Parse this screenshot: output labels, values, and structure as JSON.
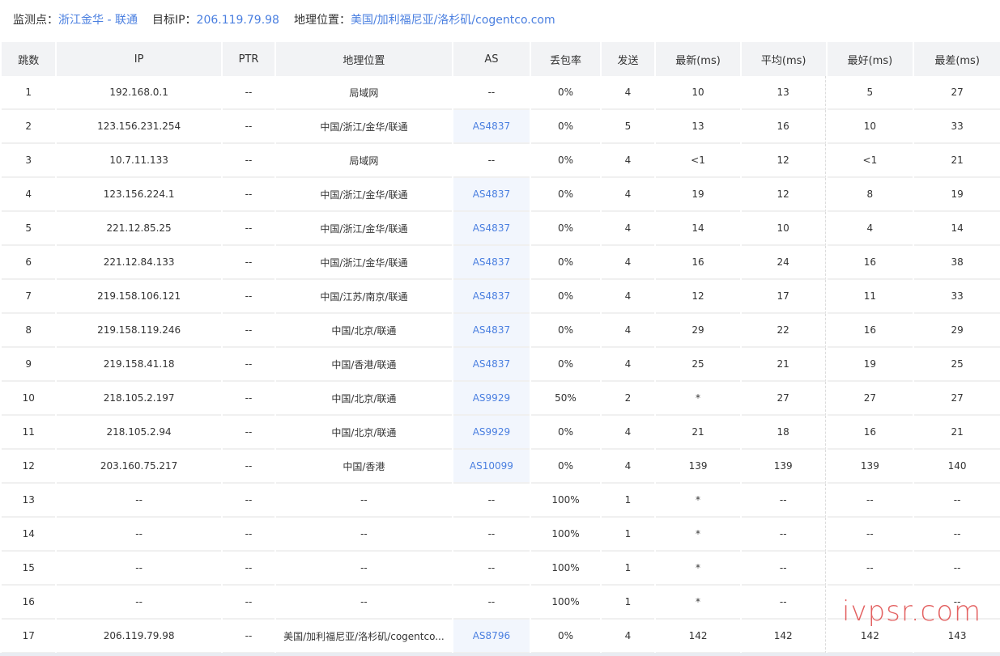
{
  "header": {
    "monitor_label": "监测点：",
    "monitor_value": "浙江金华 - 联通",
    "target_label": "目标IP：",
    "target_value": "206.119.79.98",
    "geo_label": "地理位置：",
    "geo_value": "美国/加利福尼亚/洛杉矶/cogentco.com"
  },
  "table": {
    "columns": [
      "跳数",
      "IP",
      "PTR",
      "地理位置",
      "AS",
      "丢包率",
      "发送",
      "最新(ms)",
      "平均(ms)",
      "最好(ms)",
      "最差(ms)"
    ],
    "rows": [
      {
        "hop": "1",
        "ip": "192.168.0.1",
        "ptr": "--",
        "geo": "局域网",
        "as": "--",
        "loss": "0%",
        "sent": "4",
        "last": "10",
        "avg": "13",
        "best": "5",
        "worst": "27"
      },
      {
        "hop": "2",
        "ip": "123.156.231.254",
        "ptr": "--",
        "geo": "中国/浙江/金华/联通",
        "as": "AS4837",
        "loss": "0%",
        "sent": "5",
        "last": "13",
        "avg": "16",
        "best": "10",
        "worst": "33"
      },
      {
        "hop": "3",
        "ip": "10.7.11.133",
        "ptr": "--",
        "geo": "局域网",
        "as": "--",
        "loss": "0%",
        "sent": "4",
        "last": "<1",
        "avg": "12",
        "best": "<1",
        "worst": "21"
      },
      {
        "hop": "4",
        "ip": "123.156.224.1",
        "ptr": "--",
        "geo": "中国/浙江/金华/联通",
        "as": "AS4837",
        "loss": "0%",
        "sent": "4",
        "last": "19",
        "avg": "12",
        "best": "8",
        "worst": "19"
      },
      {
        "hop": "5",
        "ip": "221.12.85.25",
        "ptr": "--",
        "geo": "中国/浙江/金华/联通",
        "as": "AS4837",
        "loss": "0%",
        "sent": "4",
        "last": "14",
        "avg": "10",
        "best": "4",
        "worst": "14"
      },
      {
        "hop": "6",
        "ip": "221.12.84.133",
        "ptr": "--",
        "geo": "中国/浙江/金华/联通",
        "as": "AS4837",
        "loss": "0%",
        "sent": "4",
        "last": "16",
        "avg": "24",
        "best": "16",
        "worst": "38"
      },
      {
        "hop": "7",
        "ip": "219.158.106.121",
        "ptr": "--",
        "geo": "中国/江苏/南京/联通",
        "as": "AS4837",
        "loss": "0%",
        "sent": "4",
        "last": "12",
        "avg": "17",
        "best": "11",
        "worst": "33"
      },
      {
        "hop": "8",
        "ip": "219.158.119.246",
        "ptr": "--",
        "geo": "中国/北京/联通",
        "as": "AS4837",
        "loss": "0%",
        "sent": "4",
        "last": "29",
        "avg": "22",
        "best": "16",
        "worst": "29"
      },
      {
        "hop": "9",
        "ip": "219.158.41.18",
        "ptr": "--",
        "geo": "中国/香港/联通",
        "as": "AS4837",
        "loss": "0%",
        "sent": "4",
        "last": "25",
        "avg": "21",
        "best": "19",
        "worst": "25"
      },
      {
        "hop": "10",
        "ip": "218.105.2.197",
        "ptr": "--",
        "geo": "中国/北京/联通",
        "as": "AS9929",
        "loss": "50%",
        "sent": "2",
        "last": "*",
        "avg": "27",
        "best": "27",
        "worst": "27"
      },
      {
        "hop": "11",
        "ip": "218.105.2.94",
        "ptr": "--",
        "geo": "中国/北京/联通",
        "as": "AS9929",
        "loss": "0%",
        "sent": "4",
        "last": "21",
        "avg": "18",
        "best": "16",
        "worst": "21"
      },
      {
        "hop": "12",
        "ip": "203.160.75.217",
        "ptr": "--",
        "geo": "中国/香港",
        "as": "AS10099",
        "loss": "0%",
        "sent": "4",
        "last": "139",
        "avg": "139",
        "best": "139",
        "worst": "140"
      },
      {
        "hop": "13",
        "ip": "--",
        "ptr": "--",
        "geo": "--",
        "as": "--",
        "loss": "100%",
        "sent": "1",
        "last": "*",
        "avg": "--",
        "best": "--",
        "worst": "--"
      },
      {
        "hop": "14",
        "ip": "--",
        "ptr": "--",
        "geo": "--",
        "as": "--",
        "loss": "100%",
        "sent": "1",
        "last": "*",
        "avg": "--",
        "best": "--",
        "worst": "--"
      },
      {
        "hop": "15",
        "ip": "--",
        "ptr": "--",
        "geo": "--",
        "as": "--",
        "loss": "100%",
        "sent": "1",
        "last": "*",
        "avg": "--",
        "best": "--",
        "worst": "--"
      },
      {
        "hop": "16",
        "ip": "--",
        "ptr": "--",
        "geo": "--",
        "as": "--",
        "loss": "100%",
        "sent": "1",
        "last": "*",
        "avg": "--",
        "best": "",
        "worst": "--"
      },
      {
        "hop": "17",
        "ip": "206.119.79.98",
        "ptr": "--",
        "geo": "美国/加利福尼亚/洛杉矶/cogentco...",
        "as": "AS8796",
        "loss": "0%",
        "sent": "4",
        "last": "142",
        "avg": "142",
        "best": "142",
        "worst": "143"
      }
    ]
  },
  "watermark": "ivpsr.com",
  "colors": {
    "link": "#4a7fe0",
    "header_bg": "#f2f3f5",
    "as_bg": "#f2f6fd",
    "watermark": "#e05050"
  }
}
